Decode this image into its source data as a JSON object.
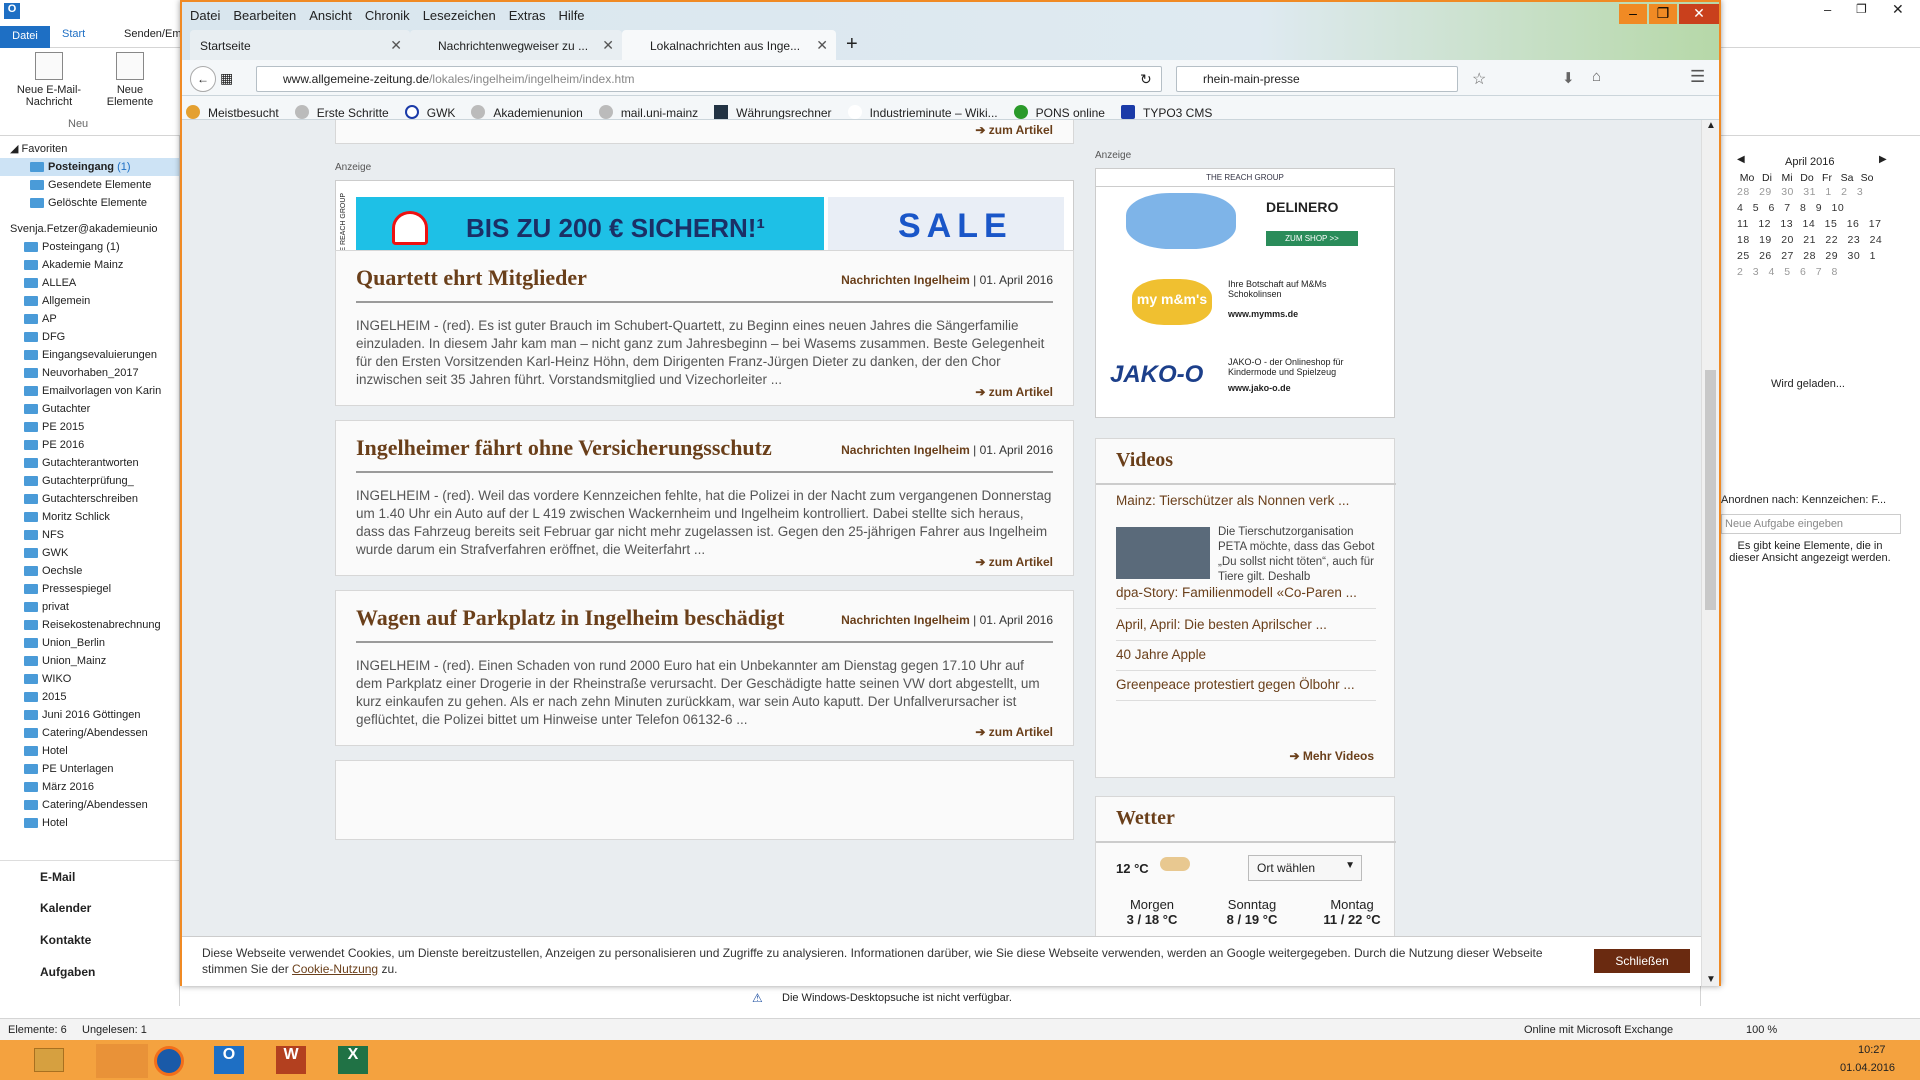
{
  "outlook": {
    "ribbon_tabs": [
      "Datei",
      "Start",
      "Senden/Em"
    ],
    "ribbon_buttons": [
      "Neue E-Mail-Nachricht",
      "Neue Elemente"
    ],
    "group_label": "Neu",
    "favorites_label": "Favoriten",
    "favorites": [
      {
        "label": "Posteingang",
        "count": "(1)"
      },
      {
        "label": "Gesendete Elemente",
        "count": ""
      },
      {
        "label": "Gelöschte Elemente",
        "count": ""
      }
    ],
    "account": "Svenja.Fetzer@akademieunio",
    "folders": [
      "Posteingang (1)",
      "Akademie Mainz",
      "ALLEA",
      "Allgemein",
      "AP",
      "DFG",
      "Eingangsevaluierungen",
      "Neuvorhaben_2017",
      "Emailvorlagen von Karin",
      "Gutachter",
      "PE 2015",
      "PE 2016",
      "Gutachterantworten",
      "Gutachterprüfung_",
      "Gutachterschreiben",
      "Moritz Schlick",
      "NFS",
      "GWK",
      "Oechsle",
      "Pressespiegel",
      "privat",
      "Reisekostenabrechnung",
      "Union_Berlin",
      "Union_Mainz",
      "WIKO",
      "2015",
      "Juni 2016 Göttingen",
      "Catering/Abendessen",
      "Hotel",
      "PE Unterlagen",
      "März 2016",
      "Catering/Abendessen",
      "Hotel"
    ],
    "nav": [
      "E-Mail",
      "Kalender",
      "Kontakte",
      "Aufgaben"
    ],
    "calendar": {
      "month": "April 2016",
      "days": [
        "Mo",
        "Di",
        "Mi",
        "Do",
        "Fr",
        "Sa",
        "So"
      ],
      "rows": [
        "28 29 30 31 1 2 3",
        "4 5 6 7 8 9 10",
        "11 12 13 14 15 16 17",
        "18 19 20 21 22 23 24",
        "25 26 27 28 29 30 1",
        "2 3 4 5 6 7 8"
      ]
    },
    "loading": "Wird geladen...",
    "tasks_sort": "Anordnen nach: Kennzeichen: F...",
    "task_placeholder": "Neue Aufgabe eingeben",
    "tasks_empty": "Es gibt keine Elemente, die in dieser Ansicht angezeigt werden.",
    "desktop_search": "Die Windows-Desktopsuche ist nicht verfügbar.",
    "status_items": "Elemente: 6",
    "status_unread": "Ungelesen: 1",
    "status_online": "Online mit Microsoft Exchange",
    "zoom": "100 %",
    "clock_time": "10:27",
    "clock_date": "01.04.2016"
  },
  "firefox": {
    "menu": [
      "Datei",
      "Bearbeiten",
      "Ansicht",
      "Chronik",
      "Lesezeichen",
      "Extras",
      "Hilfe"
    ],
    "tabs": [
      "Startseite",
      "Nachrichtenwegweiser zu ...",
      "Lokalnachrichten aus Inge..."
    ],
    "url_domain": "www.allgemeine-zeitung.de",
    "url_path": "/lokales/ingelheim/ingelheim/index.htm",
    "search_value": "rhein-main-presse",
    "bookmarks": [
      "Meistbesucht",
      "Erste Schritte",
      "GWK",
      "Akademienunion",
      "mail.uni-mainz",
      "Währungsrechner",
      "Industrieminute – Wiki...",
      "PONS online",
      "TYPO3 CMS"
    ]
  },
  "page": {
    "top_more": "zum Artikel",
    "ad_label": "Anzeige",
    "banner_group": "THE REACH GROUP",
    "banner_text": "BIS ZU 200 € SICHERN!¹",
    "banner_sale": "SALE",
    "articles": [
      {
        "title": "Quartett ehrt Mitglieder",
        "section": "Nachrichten Ingelheim",
        "date": "| 01. April 2016",
        "text": "INGELHEIM - (red). Es ist guter Brauch im Schubert-Quartett, zu Beginn eines neuen Jahres die Sängerfamilie einzuladen. In diesem Jahr kam man – nicht ganz zum Jahresbeginn – bei Wasems zusammen. Beste Gelegenheit für den Ersten Vorsitzenden Karl-Heinz Höhn, dem Dirigenten Franz-Jürgen Dieter zu danken, der den Chor inzwischen seit 35 Jahren führt. Vorstandsmitglied und Vizechorleiter ...",
        "more": "zum Artikel"
      },
      {
        "title": "Ingelheimer fährt ohne Versicherungsschutz",
        "section": "Nachrichten Ingelheim",
        "date": "| 01. April 2016",
        "text": "INGELHEIM - (red). Weil das vordere Kennzeichen fehlte, hat die Polizei in der Nacht zum vergangenen Donnerstag um 1.40 Uhr ein Auto auf der L 419 zwischen Wackernheim und Ingelheim kontrolliert. Dabei stellte sich heraus, dass das Fahrzeug bereits seit Februar gar nicht mehr zugelassen ist. Gegen den 25-jährigen Fahrer aus Ingelheim wurde darum ein Strafverfahren eröffnet, die Weiterfahrt ...",
        "more": "zum Artikel"
      },
      {
        "title": "Wagen auf Parkplatz in Ingelheim beschädigt",
        "section": "Nachrichten Ingelheim",
        "date": "| 01. April 2016",
        "text": "INGELHEIM - (red). Einen Schaden von rund 2000 Euro hat ein Unbekannter am Dienstag gegen 17.10 Uhr auf dem Parkplatz einer Drogerie in der Rheinstraße verursacht. Der Geschädigte hatte seinen VW dort abgestellt, um kurz einkaufen zu gehen. Als er nach zehn Minuten zurückkam, war sein Auto kaputt. Der Unfallverursacher ist geflüchtet, die Polizei bittet um Hinweise unter Telefon 06132-6 ...",
        "more": "zum Artikel"
      }
    ],
    "sidebar_ad": {
      "label": "Anzeige",
      "group": "THE REACH GROUP",
      "brand1": "DELINERO",
      "shop": "ZUM SHOP >>",
      "mm_text": "Ihre Botschaft auf M&Ms Schokolinsen",
      "mm_url": "www.mymms.de",
      "mm_logo": "my m&m's",
      "jako_logo": "JAKO-O",
      "jako_text": "JAKO-O - der Onlineshop für Kindermode und Spielzeug",
      "jako_url": "www.jako-o.de"
    },
    "videos": {
      "title": "Videos",
      "items": [
        "Mainz: Tierschützer als Nonnen verk ...",
        "dpa-Story: Familienmodell «Co-Paren ...",
        "April, April: Die besten Aprilscher ...",
        "40 Jahre Apple",
        "Greenpeace protestiert gegen Ölbohr ..."
      ],
      "first_text": "Die Tierschutzorganisation PETA möchte, dass das Gebot „Du sollst nicht töten“, auch für Tiere gilt. Deshalb",
      "more": "Mehr Videos"
    },
    "weather": {
      "title": "Wetter",
      "temp": "12 °C",
      "select": "Ort wählen",
      "days": [
        {
          "name": "Morgen",
          "t": "3 / 18 °C"
        },
        {
          "name": "Sonntag",
          "t": "8 / 19 °C"
        },
        {
          "name": "Montag",
          "t": "11 / 22 °C"
        }
      ]
    },
    "cookie_text": "Diese Webseite verwendet Cookies, um Dienste bereitzustellen, Anzeigen zu personalisieren und Zugriffe zu analysieren. Informationen darüber, wie Sie diese Webseite verwenden, werden an Google weitergegeben. Durch die Nutzung dieser Webseite stimmen Sie der",
    "cookie_link": "Cookie-Nutzung",
    "cookie_end": "zu.",
    "cookie_button": "Schließen"
  }
}
